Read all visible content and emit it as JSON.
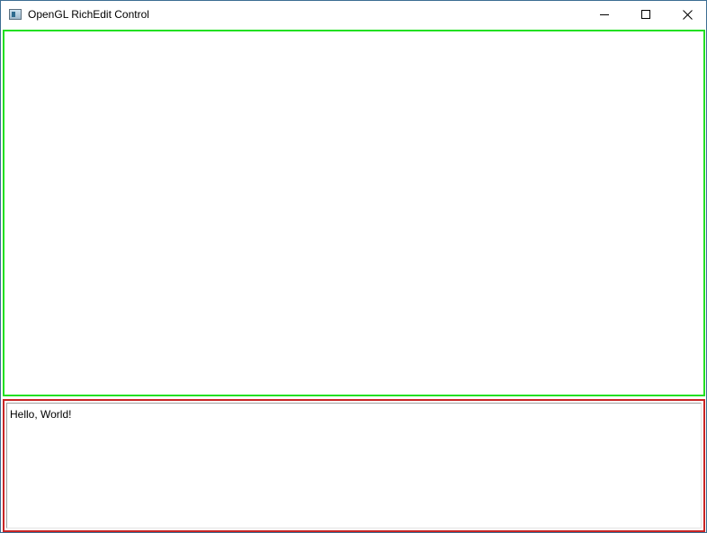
{
  "window": {
    "title": "OpenGL RichEdit Control",
    "icon": "app-window-icon",
    "controls": {
      "minimize_icon": "minimize-icon",
      "maximize_icon": "maximize-icon",
      "close_icon": "close-icon"
    }
  },
  "gl_view": {
    "border_color": "#22e022"
  },
  "rich_edit": {
    "text": "Hello, World!",
    "border_color": "#c82424"
  }
}
